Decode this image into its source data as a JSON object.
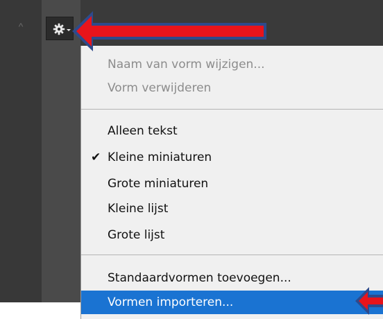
{
  "toolbar": {
    "scroll_up_glyph": "^",
    "gear_icon": "gear-icon"
  },
  "menu": {
    "groups": [
      {
        "items": [
          {
            "label": "Naam van vorm wijzigen...",
            "enabled": false,
            "checked": false
          },
          {
            "label": "Vorm verwijderen",
            "enabled": false,
            "checked": false
          }
        ]
      },
      {
        "items": [
          {
            "label": "Alleen tekst",
            "enabled": true,
            "checked": false
          },
          {
            "label": "Kleine miniaturen",
            "enabled": true,
            "checked": true
          },
          {
            "label": "Grote miniaturen",
            "enabled": true,
            "checked": false
          },
          {
            "label": "Kleine lijst",
            "enabled": true,
            "checked": false
          },
          {
            "label": "Grote lijst",
            "enabled": true,
            "checked": false
          }
        ]
      },
      {
        "items": [
          {
            "label": "Standaardvormen toevoegen...",
            "enabled": true,
            "checked": false
          },
          {
            "label": "Vormen importeren...",
            "enabled": true,
            "checked": false,
            "highlighted": true
          }
        ]
      }
    ],
    "check_glyph": "✔"
  },
  "annotations": {
    "arrow_color": "#e8141b",
    "arrow_outline": "#2e4a8c"
  },
  "colors": {
    "panel_dark": "#383838",
    "menu_background": "#f0f0f0",
    "highlight": "#1a73d2"
  }
}
